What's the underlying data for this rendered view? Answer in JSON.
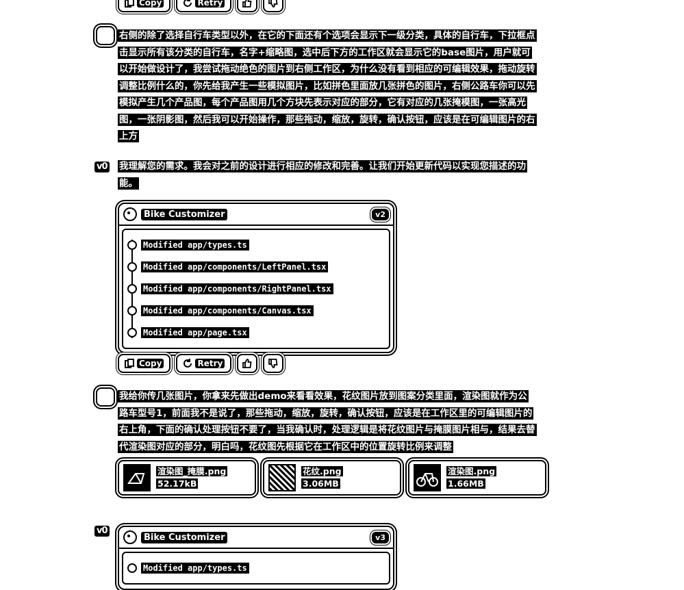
{
  "actions": {
    "copy": "Copy",
    "retry": "Retry"
  },
  "messages": {
    "user1": "右侧的除了选择自行车类型以外，在它的下面还有个选项会显示下一级分类，具体的自行车，下拉框点击显示所有该分类的自行车，名字+缩略图，选中后下方的工作区就会显示它的base图片，用户就可以开始做设计了，我尝试拖动绝色的图片到右侧工作区，为什么没有看到相应的可编辑效果，拖动旋转调整比例什么的，你先给我产生一些模拟图片，比如拼色里面放几张拼色的图片，右侧公路车你可以先模拟产生几个产品图，每个产品图用几个方块先表示对应的部分，它有对应的几张掩模图，一张高光图，一张阴影图，然后我可以开始操作，那些拖动，缩放，旋转，确认按钮，应该是在可编辑图片的右上方",
    "v0_1": "我理解您的需求。我会对之前的设计进行相应的修改和完善。让我们开始更新代码以实现您描述的功能。",
    "user2": "我给你传几张图片，你拿来先做出demo来看看效果，花纹图片放到图案分类里面，渲染图就作为公路车型号1，前面我不是说了，那些拖动，缩放，旋转，确认按钮，应该是在工作区里的可编辑图片的右上角，下面的确认处理按钮不要了，当我确认时，处理逻辑是将花纹图片与掩膜图片相与，结果去替代渲染图对应的部分，明白吗，花纹图先根据它在工作区中的位置旋转比例来调整"
  },
  "avatar_v0": "v0",
  "card1": {
    "title": "Bike Customizer",
    "version": "v2",
    "files": [
      "Modified app/types.ts",
      "Modified app/components/LeftPanel.tsx",
      "Modified app/components/RightPanel.tsx",
      "Modified app/components/Canvas.tsx",
      "Modified app/page.tsx"
    ]
  },
  "attachments": [
    {
      "name": "渲染图_掩膜.png",
      "size": "52.17kB"
    },
    {
      "name": "花纹.png",
      "size": "3.06MB"
    },
    {
      "name": "渲染图.png",
      "size": "1.66MB"
    }
  ],
  "card2": {
    "title": "Bike Customizer",
    "version": "v3",
    "files": [
      "Modified app/types.ts"
    ]
  }
}
